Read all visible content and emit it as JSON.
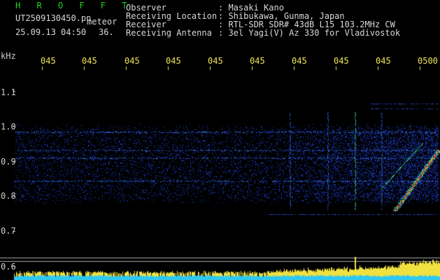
{
  "header": {
    "title": "H R O F F T",
    "filename": "UT2509130450.pn",
    "file_suffix": "meteor",
    "datetime": "25.09.13 04:50",
    "count": "36.",
    "fields": [
      {
        "label": "Observer",
        "value": ": Masaki Kano"
      },
      {
        "label": "Receiving Location",
        "value": ": Shibukawa, Gunma, Japan"
      },
      {
        "label": "Receiver",
        "value": ": RTL-SDR SDR# 43dB L15 103.2MHz CW"
      },
      {
        "label": "Receiving Antenna",
        "value": ": 3el Yagi(V) Az 330 for Vladivostok"
      }
    ]
  },
  "axis": {
    "unit": "kHz",
    "y_labels": [
      "1.1",
      "1.0",
      "0.9",
      "0.8",
      "0.7",
      "0.6"
    ],
    "x_labels": [
      "045",
      "045",
      "045",
      "045",
      "045",
      "045",
      "045",
      "045",
      "045",
      "0500"
    ]
  },
  "colors": {
    "background": "#000000",
    "noise": "#1c38c8",
    "ticks": "#f2e65a",
    "title": "#1bd51b",
    "baseline": "#2ec8f0"
  }
}
